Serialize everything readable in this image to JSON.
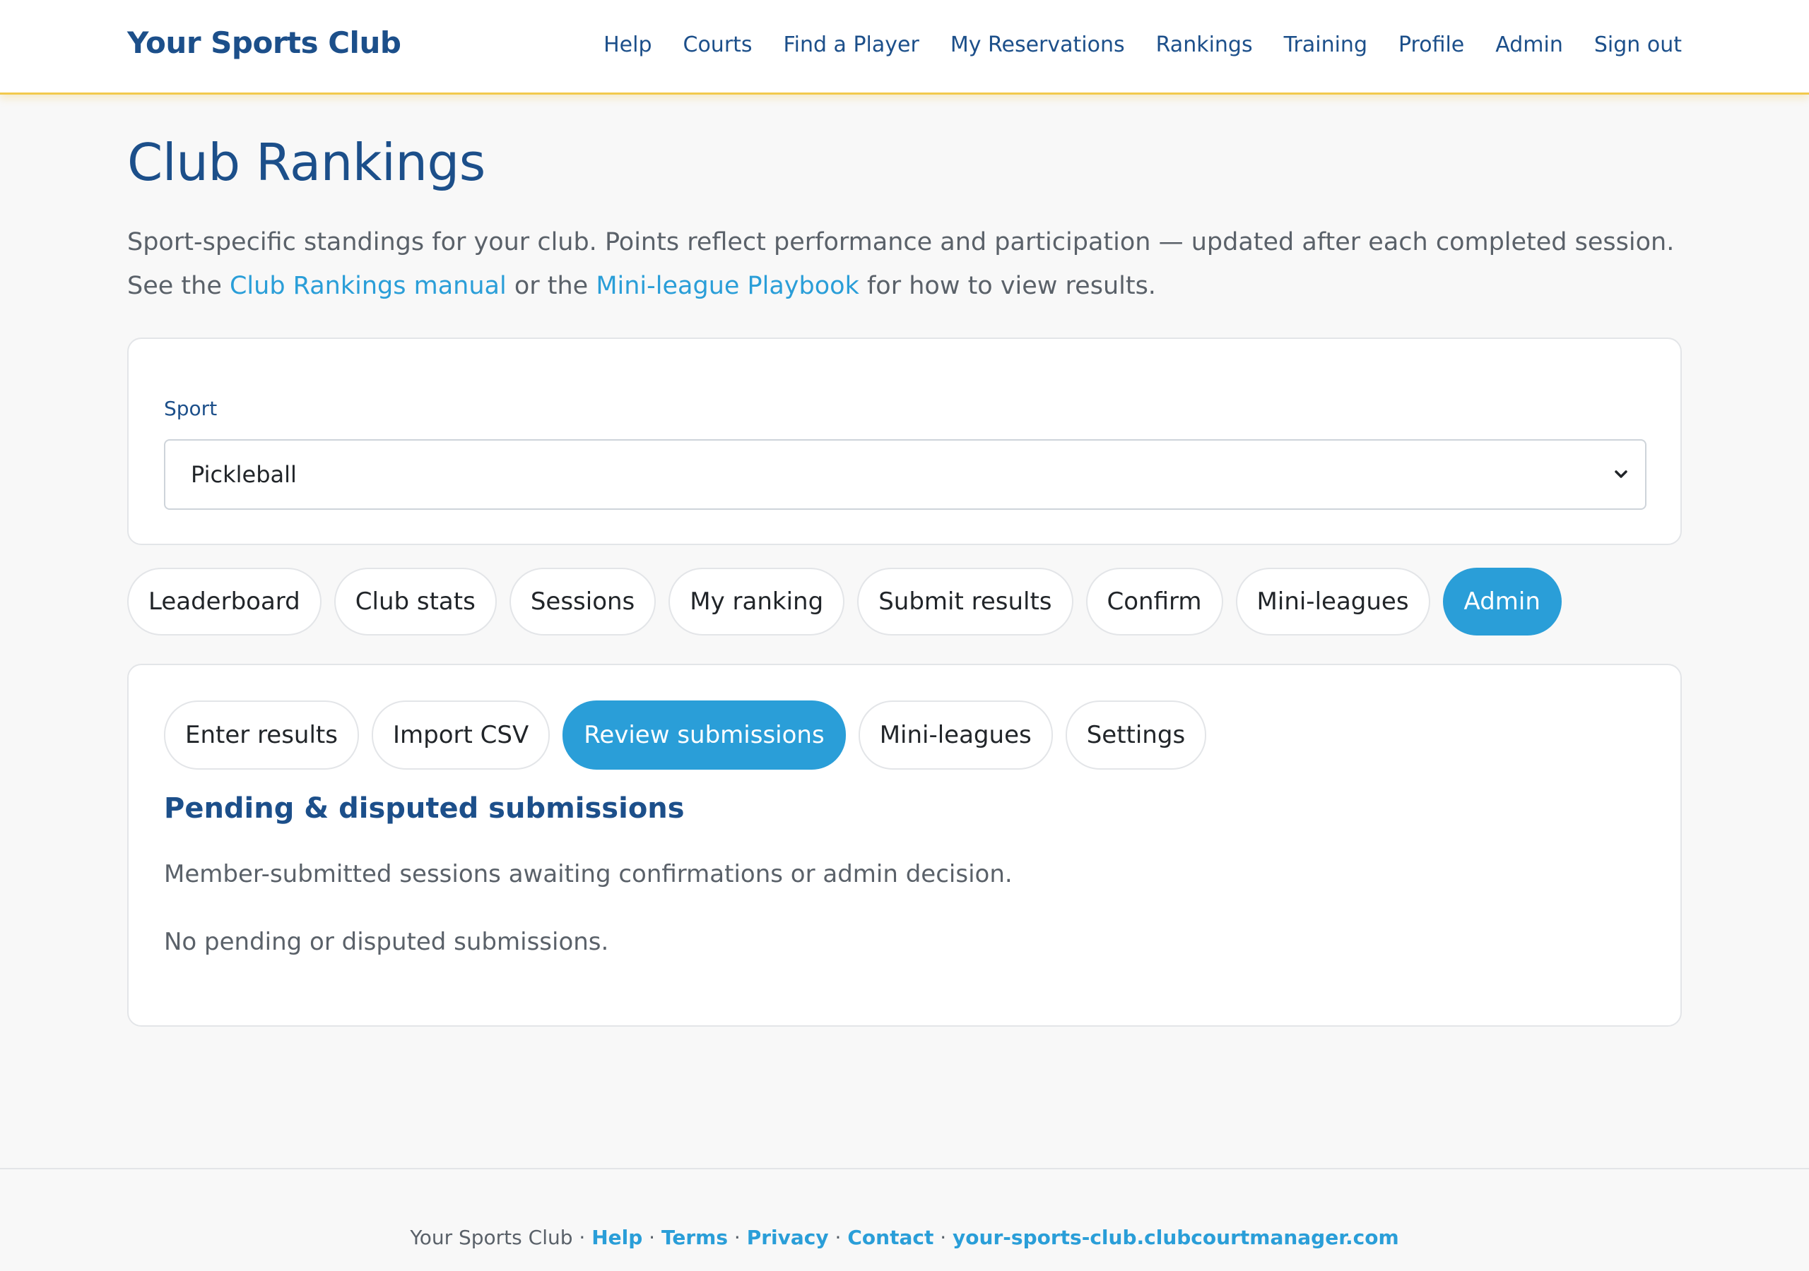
{
  "header": {
    "brand": "Your Sports Club",
    "nav": [
      "Help",
      "Courts",
      "Find a Player",
      "My Reservations",
      "Rankings",
      "Training",
      "Profile",
      "Admin",
      "Sign out"
    ]
  },
  "page": {
    "title": "Club Rankings",
    "intro_1": "Sport-specific standings for your club. Points reflect performance and participation — updated after each completed session. See the ",
    "intro_link_1": "Club Rankings manual",
    "intro_2": " or the ",
    "intro_link_2": "Mini-league Playbook",
    "intro_3": " for how to view results."
  },
  "sport": {
    "label": "Sport",
    "selected": "Pickleball"
  },
  "main_tabs": {
    "items": [
      "Leaderboard",
      "Club stats",
      "Sessions",
      "My ranking",
      "Submit results",
      "Confirm",
      "Mini-leagues",
      "Admin"
    ],
    "active": "Admin"
  },
  "admin_tabs": {
    "items": [
      "Enter results",
      "Import CSV",
      "Review submissions",
      "Mini-leagues",
      "Settings"
    ],
    "active": "Review submissions"
  },
  "review": {
    "title": "Pending & disputed submissions",
    "description": "Member-submitted sessions awaiting confirmations or admin decision.",
    "empty": "No pending or disputed submissions."
  },
  "footer": {
    "club": "Your Sports Club",
    "links": [
      "Help",
      "Terms",
      "Privacy",
      "Contact",
      "your-sports-club.clubcourtmanager.com"
    ],
    "separator": " · "
  },
  "colors": {
    "brand": "#1c4f8a",
    "accent": "#2a9ed8",
    "header_border": "#f2c94c"
  }
}
